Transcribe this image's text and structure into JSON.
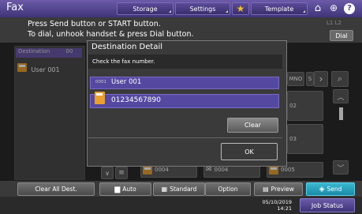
{
  "header": {
    "title": "Fax",
    "storage_label": "Storage",
    "settings_label": "Settings",
    "template_label": "Template",
    "colors": {
      "bar": "#4f4290",
      "accent_send": "#1aa0c0"
    }
  },
  "message": {
    "line1": "Press Send button or START button.",
    "line2": "To dial, unhook handset & press Dial button.",
    "dial_label": "Dial",
    "line_indicator": "L1 L2"
  },
  "destinations": {
    "header": "Destination",
    "count": "00",
    "items": [
      "User 001"
    ]
  },
  "background": {
    "tab_mno": "MNO",
    "tab_s": "S",
    "rows": [
      "0004",
      "0004",
      "0005"
    ],
    "side_values": [
      "02",
      "02",
      "03",
      "03"
    ]
  },
  "dialog": {
    "title": "Destination Detail",
    "message": "Check the fax number.",
    "rows": [
      {
        "index": "0001",
        "label": "User 001"
      },
      {
        "label": "01234567890"
      }
    ],
    "clear_label": "Clear",
    "ok_label": "OK"
  },
  "bottom": {
    "clear_all": "Clear All Dest.",
    "auto": "Auto",
    "standard": "Standard",
    "option": "Option",
    "preview": "Preview",
    "send": "Send"
  },
  "status": {
    "date": "05/10/2019",
    "time": "14:21",
    "job_status": "Job Status"
  }
}
